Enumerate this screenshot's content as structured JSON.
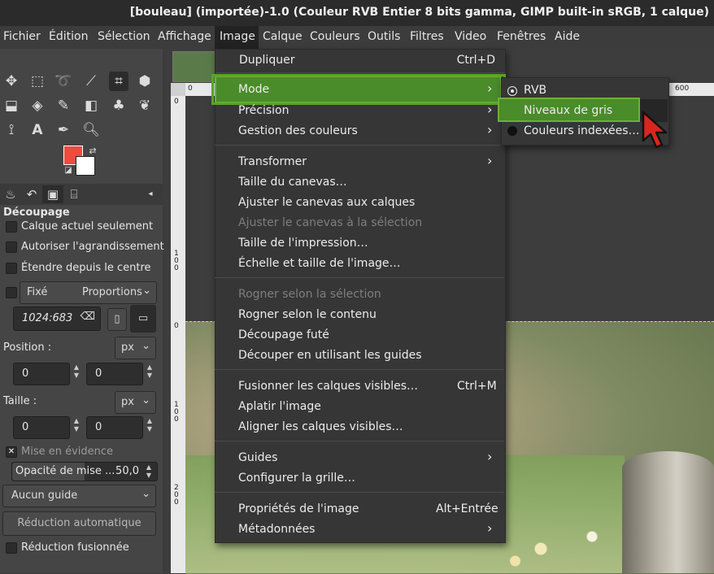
{
  "window": {
    "title": "[bouleau] (importée)-1.0 (Couleur RVB Entier 8 bits gamma, GIMP built-in sRGB, 1 calque)"
  },
  "menubar": {
    "items": [
      "Fichier",
      "Édition",
      "Sélection",
      "Affichage",
      "Image",
      "Calque",
      "Couleurs",
      "Outils",
      "Filtres",
      "Video",
      "Fenêtres",
      "Aide"
    ]
  },
  "image_menu": {
    "dupliquer": {
      "label": "Dupliquer",
      "shortcut": "Ctrl+D"
    },
    "mode": "Mode",
    "precision": "Précision",
    "gestion_couleurs": "Gestion des couleurs",
    "transformer": "Transformer",
    "taille_canevas": "Taille du canevas…",
    "ajuster_calques": "Ajuster le canevas aux calques",
    "ajuster_selection": "Ajuster le canevas à la sélection",
    "taille_impression": "Taille de l'impression…",
    "echelle": "Échelle et taille de l'image…",
    "rogner_selection": "Rogner selon la sélection",
    "rogner_contenu": "Rogner selon le contenu",
    "decoupage_fute": "Découpage futé",
    "decouper_guides": "Découper en utilisant les guides",
    "fusionner": {
      "label": "Fusionner les calques visibles…",
      "shortcut": "Ctrl+M"
    },
    "aplatir": "Aplatir l'image",
    "aligner": "Aligner les calques visibles…",
    "guides": "Guides",
    "grille": "Configurer la grille…",
    "proprietes": {
      "label": "Propriétés de l'image",
      "shortcut": "Alt+Entrée"
    },
    "metadonnees": "Métadonnées"
  },
  "mode_submenu": {
    "rvb": "RVB",
    "niveaux_gris": "Niveaux de gris",
    "couleurs_indexees": "Couleurs indexées…"
  },
  "tool_options": {
    "title": "Découpage",
    "calque_actuel": "Calque actuel seulement",
    "autoriser": "Autoriser l'agrandissement",
    "etendre": "Étendre depuis le centre",
    "fixe": "Fixé",
    "proportions": "Proportions",
    "ratio": "1024:683",
    "position_label": "Position :",
    "position_unit": "px",
    "pos_x": "0",
    "pos_y": "0",
    "taille_label": "Taille :",
    "taille_unit": "px",
    "size_w": "0",
    "size_h": "0",
    "mise_en_evidence": "Mise en évidence",
    "opacite_label": "Opacité de mise ...",
    "opacite_value": "50,0",
    "guide": "Aucun guide",
    "reduction_auto": "Réduction automatique",
    "reduction_fusionnee": "Réduction fusionnée"
  },
  "rulers": {
    "top_0": "0",
    "top_600": "600",
    "left_0": "0",
    "left_100": "100",
    "left_0b": "0",
    "left_100b": "100",
    "left_200": "200"
  },
  "colors": {
    "foreground": "#ee4c3f",
    "background": "#ffffff",
    "highlight": "#4a8b2a"
  }
}
